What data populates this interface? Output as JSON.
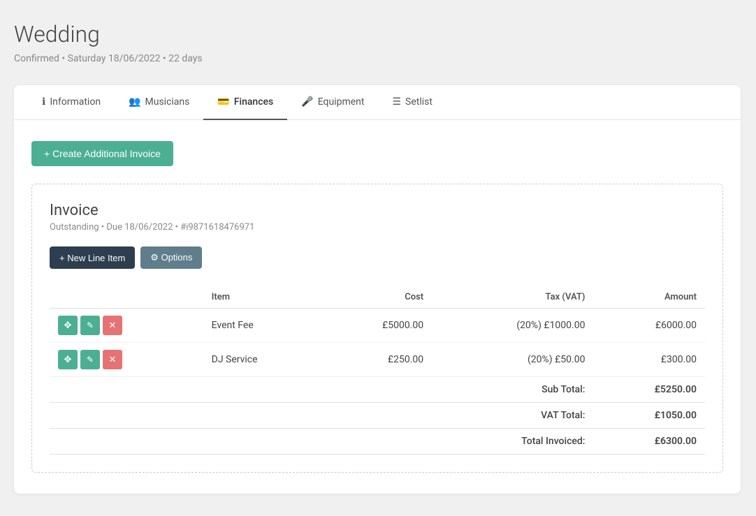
{
  "page": {
    "title": "Wedding",
    "subtitle": "Confirmed • Saturday 18/06/2022 • 22 days"
  },
  "tabs": [
    {
      "id": "information",
      "label": "Information",
      "icon": "ℹ",
      "active": false
    },
    {
      "id": "musicians",
      "label": "Musicians",
      "icon": "👥",
      "active": false
    },
    {
      "id": "finances",
      "label": "Finances",
      "icon": "💳",
      "active": true
    },
    {
      "id": "equipment",
      "label": "Equipment",
      "icon": "🎤",
      "active": false
    },
    {
      "id": "setlist",
      "label": "Setlist",
      "icon": "☰",
      "active": false
    }
  ],
  "create_button": "+ Create Additional Invoice",
  "invoice": {
    "title": "Invoice",
    "status": "Outstanding",
    "due": "Due 18/06/2022",
    "id": "#i9871618476971",
    "meta": "Outstanding • Due 18/06/2022 • #i9871618476971",
    "btn_new_line": "+ New Line Item",
    "btn_options": "⚙ Options",
    "table": {
      "headers": [
        "",
        "Item",
        "Cost",
        "Tax (VAT)",
        "Amount"
      ],
      "rows": [
        {
          "item": "Event Fee",
          "cost": "£5000.00",
          "tax": "(20%) £1000.00",
          "amount": "£6000.00"
        },
        {
          "item": "DJ Service",
          "cost": "£250.00",
          "tax": "(20%) £50.00",
          "amount": "£300.00"
        }
      ],
      "subtotal_label": "Sub Total:",
      "subtotal_value": "£5250.00",
      "vat_label": "VAT Total:",
      "vat_value": "£1050.00",
      "total_label": "Total Invoiced:",
      "total_value": "£6300.00"
    }
  },
  "icons": {
    "plus": "+",
    "move": "✥",
    "edit": "✎",
    "delete": "✕",
    "gear": "⚙"
  }
}
